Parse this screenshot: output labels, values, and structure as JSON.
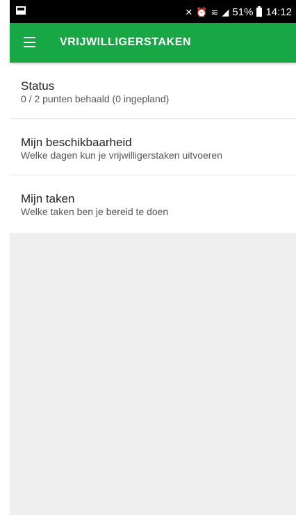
{
  "status_bar": {
    "battery_percent": "51%",
    "time": "14:12",
    "icons": [
      "image-notification-icon",
      "mute-icon",
      "alarm-icon",
      "wifi-icon",
      "signal-icon",
      "battery-icon"
    ]
  },
  "app_bar": {
    "title": "VRIJWILLIGERSTAKEN",
    "menu_icon": "hamburger-menu-icon",
    "color": "#17a745"
  },
  "items": [
    {
      "title": "Status",
      "subtitle": "0 / 2 punten behaald (0 ingepland)"
    },
    {
      "title": "Mijn beschikbaarheid",
      "subtitle": "Welke dagen kun je vrijwilligerstaken uitvoeren"
    },
    {
      "title": "Mijn taken",
      "subtitle": "Welke taken ben je bereid te doen"
    }
  ]
}
